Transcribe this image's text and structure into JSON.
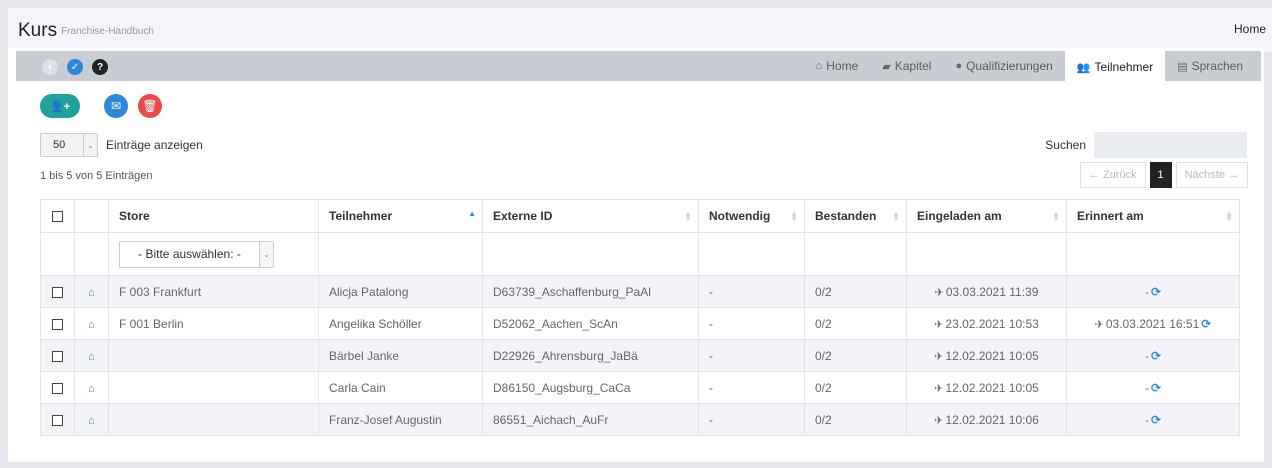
{
  "app": {
    "title": "Kurs",
    "subtitle": "Franchise-Handbuch",
    "home_link": "Home"
  },
  "header_icons": [
    {
      "name": "back-icon",
      "glyph": "‹"
    },
    {
      "name": "check-icon",
      "glyph": "✓"
    },
    {
      "name": "help-icon",
      "glyph": "?"
    }
  ],
  "tabs": [
    {
      "label": "Home",
      "icon": "home-icon",
      "glyph": "⌂",
      "active": false
    },
    {
      "label": "Kapitel",
      "icon": "book-icon",
      "glyph": "▰",
      "active": false
    },
    {
      "label": "Qualifizierungen",
      "icon": "circle-icon",
      "glyph": "●",
      "active": false
    },
    {
      "label": "Teilnehmer",
      "icon": "users-icon",
      "glyph": "👥",
      "active": true
    },
    {
      "label": "Sprachen",
      "icon": "language-icon",
      "glyph": "▤",
      "active": false
    }
  ],
  "actions": {
    "add_glyph": "👤+",
    "mail_glyph": "✉",
    "delete_glyph": "🗑"
  },
  "length": {
    "value": "50",
    "label": "Einträge anzeigen"
  },
  "search": {
    "label": "Suchen",
    "value": ""
  },
  "info": "1 bis 5 von 5 Einträgen",
  "pager": {
    "prev": "← Zurück",
    "current": "1",
    "next": "Nächste →"
  },
  "table": {
    "columns": [
      "Store",
      "Teilnehmer",
      "Externe ID",
      "Notwendig",
      "Bestanden",
      "Eingeladen am",
      "Erinnert am"
    ],
    "filter_placeholder": "- Bitte auswählen: -",
    "rows": [
      {
        "store": "F 003 Frankfurt",
        "teilnehmer": "Alicja Patalong",
        "externe_id": "D63739_Aschaffenburg_PaAl",
        "notwendig": "-",
        "bestanden": "0/2",
        "eingeladen": "03.03.2021 11:39",
        "erinnert": "-"
      },
      {
        "store": "F 001 Berlin",
        "teilnehmer": "Angelika Schöller",
        "externe_id": "D52062_Aachen_ScAn",
        "notwendig": "-",
        "bestanden": "0/2",
        "eingeladen": "23.02.2021 10:53",
        "erinnert": "03.03.2021 16:51"
      },
      {
        "store": "",
        "teilnehmer": "Bärbel Janke",
        "externe_id": "D22926_Ahrensburg_JaBä",
        "notwendig": "-",
        "bestanden": "0/2",
        "eingeladen": "12.02.2021 10:05",
        "erinnert": "-"
      },
      {
        "store": "",
        "teilnehmer": "Carla Cain",
        "externe_id": "D86150_Augsburg_CaCa",
        "notwendig": "-",
        "bestanden": "0/2",
        "eingeladen": "12.02.2021 10:05",
        "erinnert": "-"
      },
      {
        "store": "",
        "teilnehmer": "Franz-Josef Augustin",
        "externe_id": "86551_Aichach_AuFr",
        "notwendig": "-",
        "bestanden": "0/2",
        "eingeladen": "12.02.2021 10:06",
        "erinnert": "-"
      }
    ]
  },
  "colors": {
    "accent": "#2f87d9",
    "add": "#1ea29a",
    "delete": "#ec4b4b",
    "header_bar": "#c8cdd4"
  }
}
